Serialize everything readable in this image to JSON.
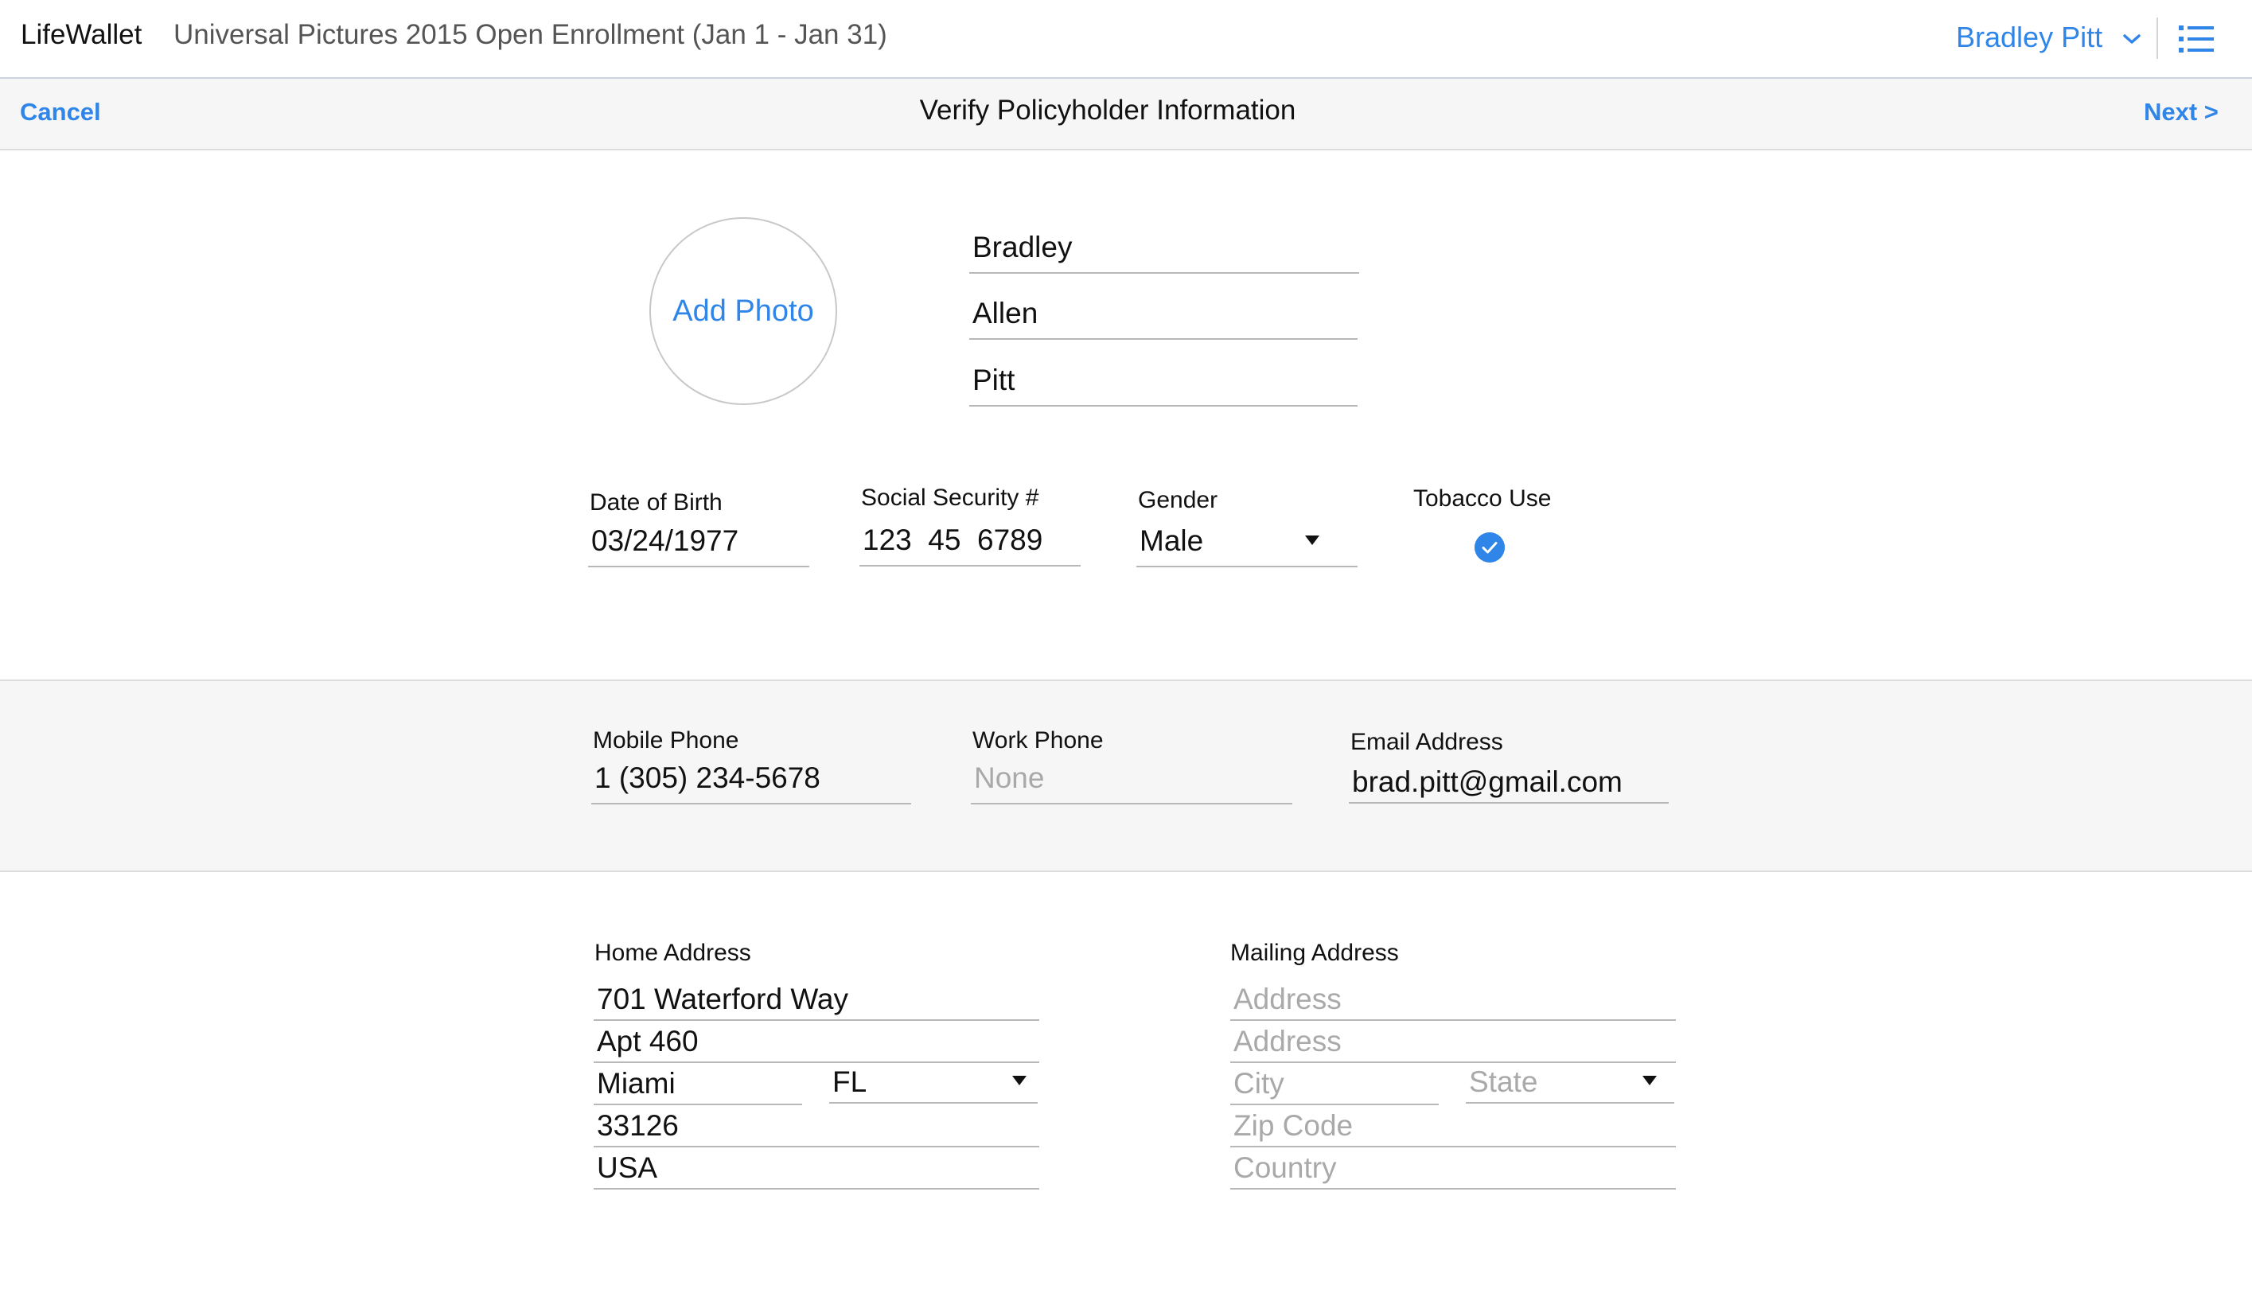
{
  "header": {
    "brand": "LifeWallet",
    "enrollment": "Universal Pictures 2015 Open Enrollment (Jan 1 - Jan 31)",
    "user_name": "Bradley Pitt",
    "user_menu_icon": "chevron-down-icon",
    "menu_icon": "list-icon"
  },
  "subheader": {
    "cancel_label": "Cancel",
    "title": "Verify Policyholder Information",
    "next_label": "Next >"
  },
  "profile": {
    "add_photo_label": "Add Photo",
    "first_name": "Bradley",
    "middle_name": "Allen",
    "last_name": "Pitt"
  },
  "details": {
    "dob_label": "Date of Birth",
    "dob_value": "03/24/1977",
    "ssn_label": "Social Security #",
    "ssn_value": "123  45  6789",
    "gender_label": "Gender",
    "gender_value": "Male",
    "tobacco_label": "Tobacco Use",
    "tobacco_checked": true
  },
  "contact": {
    "mobile_label": "Mobile Phone",
    "mobile_value": "1 (305) 234-5678",
    "work_label": "Work Phone",
    "work_placeholder": "None",
    "email_label": "Email Address",
    "email_value": "brad.pitt@gmail.com"
  },
  "home_address": {
    "label": "Home Address",
    "line1": "701 Waterford Way",
    "line2": "Apt 460",
    "city": "Miami",
    "state": "FL",
    "zip": "33126",
    "country": "USA"
  },
  "mailing_address": {
    "label": "Mailing Address",
    "line1_placeholder": "Address",
    "line2_placeholder": "Address",
    "city_placeholder": "City",
    "state_placeholder": "State",
    "zip_placeholder": "Zip Code",
    "country_placeholder": "Country"
  },
  "colors": {
    "accent": "#2f86e8",
    "band_bg": "#f6f6f6",
    "placeholder": "#a9a9a9"
  }
}
